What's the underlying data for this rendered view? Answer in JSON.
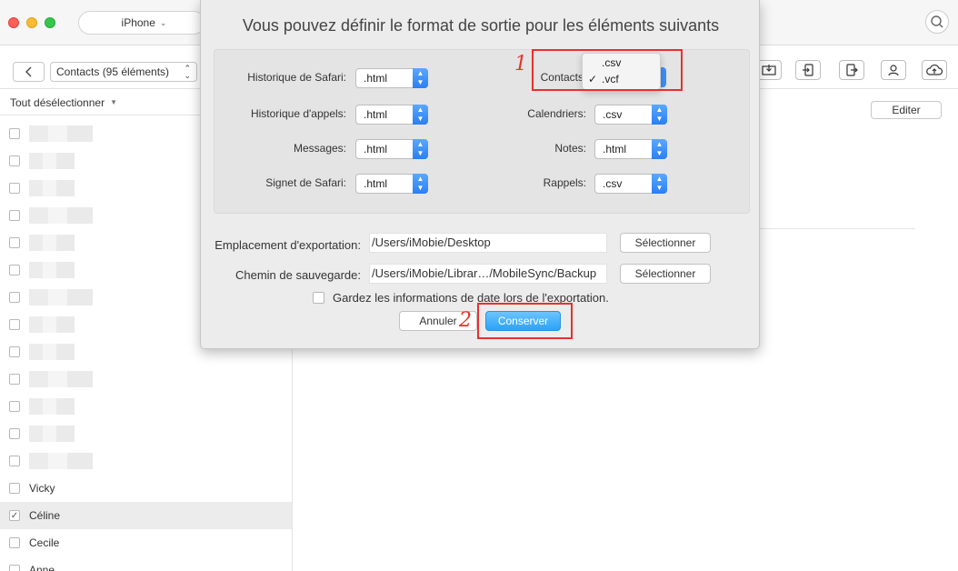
{
  "titlebar": {
    "device_name": "iPhone"
  },
  "toolbar": {
    "category_select": "Contacts (95 éléments)"
  },
  "list": {
    "header": "Tout désélectionner",
    "blurred_rows": 13,
    "named_rows": [
      {
        "name": "Vicky",
        "checked": false
      },
      {
        "name": "Céline",
        "checked": true
      },
      {
        "name": "Cecile",
        "checked": false
      },
      {
        "name": "Anne",
        "checked": false
      }
    ]
  },
  "right": {
    "edit_label": "Editer"
  },
  "dialog": {
    "title": "Vous pouvez définir le format de sortie pour les éléments suivants",
    "formats_left": [
      {
        "label": "Historique de Safari:",
        "value": ".html"
      },
      {
        "label": "Historique d'appels:",
        "value": ".html"
      },
      {
        "label": "Messages:",
        "value": ".html"
      },
      {
        "label": "Signet de Safari:",
        "value": ".html"
      }
    ],
    "formats_right": [
      {
        "label": "Contacts",
        "value": ".vcf"
      },
      {
        "label": "Calendriers:",
        "value": ".csv"
      },
      {
        "label": "Notes:",
        "value": ".html"
      },
      {
        "label": "Rappels:",
        "value": ".csv"
      }
    ],
    "contacts_options": [
      {
        "label": ".csv",
        "checked": false
      },
      {
        "label": ".vcf",
        "checked": true
      }
    ],
    "export_location_label": "Emplacement d'exportation:",
    "export_location_value": "/Users/iMobie/Desktop",
    "backup_path_label": "Chemin de sauvegarde:",
    "backup_path_value": "/Users/iMobie/Librar…/MobileSync/Backup",
    "select_label": "Sélectionner",
    "keep_date_label": "Gardez les informations de date lors de l'exportation.",
    "cancel_label": "Annuler",
    "save_label": "Conserver"
  },
  "annotations": {
    "step1": "1",
    "step2": "2"
  },
  "colors": {
    "accent": "#2ba3f7",
    "annotation": "#e8312a"
  }
}
